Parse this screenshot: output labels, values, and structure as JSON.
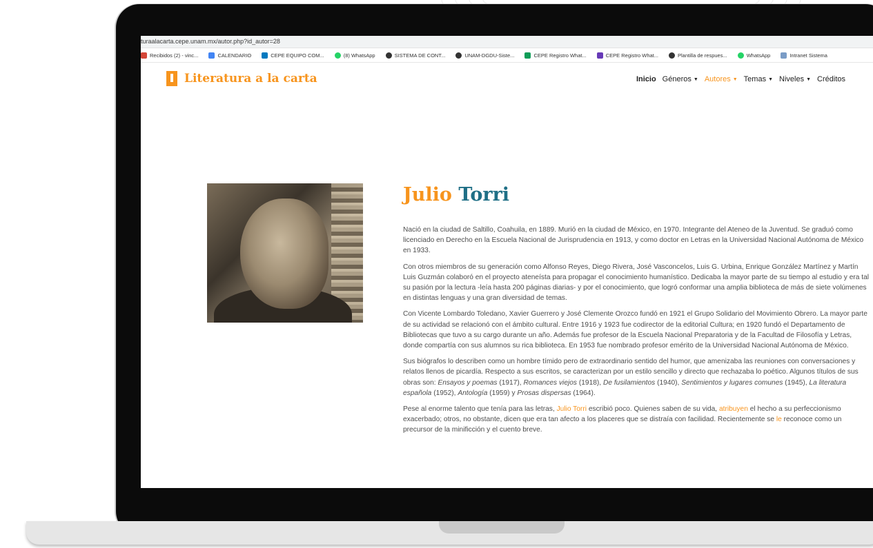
{
  "browser": {
    "url": "turaalacarta.cepe.unam.mx/autor.php?id_autor=28",
    "bookmarks": [
      {
        "label": "Recibidos (2) - vinc...",
        "icon": "gmail-icon",
        "color": "#d44638"
      },
      {
        "label": "CALENDARIO",
        "icon": "calendar-icon",
        "color": "#4285f4"
      },
      {
        "label": "CEPE EQUIPO COM...",
        "icon": "trello-icon",
        "color": "#0079bf"
      },
      {
        "label": "(8) WhatsApp",
        "icon": "whatsapp-icon",
        "color": "#25d366"
      },
      {
        "label": "SISTEMA DE CONT...",
        "icon": "globe-icon",
        "color": "#333333"
      },
      {
        "label": "UNAM-DGDU-Siste...",
        "icon": "globe-icon",
        "color": "#333333"
      },
      {
        "label": "CEPE Registro What...",
        "icon": "sheets-icon",
        "color": "#0f9d58"
      },
      {
        "label": "CEPE Registro What...",
        "icon": "forms-icon",
        "color": "#673ab7"
      },
      {
        "label": "Plantilla de respues...",
        "icon": "globe-icon",
        "color": "#333333"
      },
      {
        "label": "WhatsApp",
        "icon": "whatsapp-icon",
        "color": "#25d366"
      },
      {
        "label": "Intranet Sistema",
        "icon": "intranet-icon",
        "color": "#7a9cc6"
      }
    ]
  },
  "site": {
    "brand": "Literatura a la carta",
    "accent": "#f7941d",
    "nav": [
      {
        "label": "Inicio",
        "dropdown": false,
        "bold": true,
        "active": false
      },
      {
        "label": "Géneros",
        "dropdown": true,
        "bold": false,
        "active": false
      },
      {
        "label": "Autores",
        "dropdown": true,
        "bold": false,
        "active": true
      },
      {
        "label": "Temas",
        "dropdown": true,
        "bold": false,
        "active": false
      },
      {
        "label": "Niveles",
        "dropdown": true,
        "bold": false,
        "active": false
      },
      {
        "label": "Créditos",
        "dropdown": false,
        "bold": false,
        "active": false
      }
    ]
  },
  "author": {
    "first_name": "Julio",
    "last_name": "Torri",
    "paragraphs": [
      [
        {
          "t": "Nació en la ciudad de Saltillo, Coahuila, en 1889. Murió en la ciudad de México, en 1970. Integrante del Ateneo de la Juventud. Se graduó como licenciado en Derecho en la Escuela Nacional de Jurisprudencia en 1913, y como doctor en Letras en la Universidad Nacional Autónoma de México en 1933."
        }
      ],
      [
        {
          "t": "Con otros miembros de su generación como Alfonso Reyes, Diego Rivera, José Vasconcelos, Luis G. Urbina, Enrique González Martínez y Martín Luis Guzmán colaboró en el proyecto ateneísta para propagar el conocimiento humanístico. Dedicaba la mayor parte de su tiempo al estudio y era tal su pasión por la lectura -leía hasta 200 páginas diarias- y por el conocimiento, que logró conformar una amplia biblioteca de más de siete volúmenes en distintas lenguas y una gran diversidad de temas."
        }
      ],
      [
        {
          "t": "Con Vicente Lombardo Toledano, Xavier Guerrero y José Clemente Orozco fundó en 1921 el Grupo Solidario del Movimiento Obrero. La mayor parte de su actividad se relacionó con el ámbito cultural. Entre 1916 y 1923 fue codirector de la editorial Cultura; en 1920 fundó el Departamento de Bibliotecas que tuvo a su cargo durante un año. Además fue profesor de la Escuela Nacional Preparatoria y de la Facultad de Filosofía y Letras, donde compartía con sus alumnos su rica biblioteca. En 1953 fue nombrado profesor emérito de la Universidad Nacional Autónoma de México."
        }
      ],
      [
        {
          "t": "Sus biógrafos lo describen como un hombre tímido pero de extraordinario sentido del humor, que amenizaba las reuniones con conversaciones y relatos llenos de picardía. Respecto a sus escritos, se caracterizan por un estilo sencillo y directo que rechazaba lo poético. Algunos títulos de sus obras son: "
        },
        {
          "t": "Ensayos y poemas",
          "i": true
        },
        {
          "t": " (1917), "
        },
        {
          "t": "Romances viejos",
          "i": true
        },
        {
          "t": " (1918), "
        },
        {
          "t": "De fusilamientos",
          "i": true
        },
        {
          "t": " (1940), "
        },
        {
          "t": "Sentimientos y lugares comunes",
          "i": true
        },
        {
          "t": " (1945), "
        },
        {
          "t": "La literatura española",
          "i": true
        },
        {
          "t": " (1952), "
        },
        {
          "t": "Antología",
          "i": true
        },
        {
          "t": " (1959) y "
        },
        {
          "t": "Prosas dispersas",
          "i": true
        },
        {
          "t": " (1964)."
        }
      ],
      [
        {
          "t": "Pese al enorme talento que tenía para las letras, "
        },
        {
          "t": "Julio Torri",
          "hl": true
        },
        {
          "t": " escribió poco. Quienes saben de su vida, "
        },
        {
          "t": "atribuyen",
          "hl": true
        },
        {
          "t": " el hecho a su perfeccionismo exacerbado; otros, no obstante, dicen que era tan afecto a los placeres que se distraía con facilidad. Recientemente se "
        },
        {
          "t": "le",
          "hl": true
        },
        {
          "t": " reconoce como un precursor de la minificción y el cuento breve."
        }
      ]
    ]
  }
}
